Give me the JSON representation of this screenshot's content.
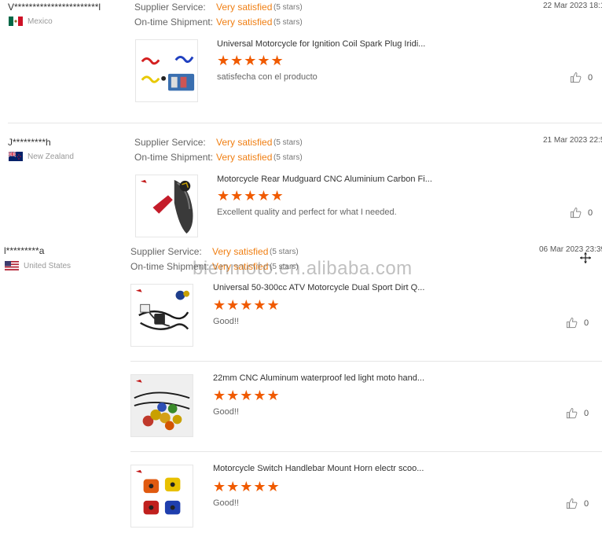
{
  "reviews": [
    {
      "buyer": "V***********************l",
      "country": "Mexico",
      "supplier_label": "Supplier Service:",
      "supplier_rating": "Very satisfied",
      "supplier_stars": "(5 stars)",
      "shipment_label": "On-time Shipment:",
      "shipment_rating": "Very satisfied",
      "shipment_stars": "(5 stars)",
      "date": "22 Mar 2023 18:1",
      "products": [
        {
          "title": "Universal Motorcycle for Ignition Coil Spark Plug Iridi...",
          "stars": "★★★★★",
          "comment": "satisfecha con el producto",
          "likes": "0"
        }
      ]
    },
    {
      "buyer": "J*********h",
      "country": "New Zealand",
      "supplier_label": "Supplier Service:",
      "supplier_rating": "Very satisfied",
      "supplier_stars": "(5 stars)",
      "shipment_label": "On-time Shipment:",
      "shipment_rating": "Very satisfied",
      "shipment_stars": "(5 stars)",
      "date": "21 Mar 2023 22:5",
      "products": [
        {
          "title": "Motorcycle Rear Mudguard CNC Aluminium Carbon Fi...",
          "stars": "★★★★★",
          "comment": "Excellent quality and perfect for what I needed.",
          "likes": "0"
        }
      ]
    },
    {
      "buyer": "l*********a",
      "country": "United States",
      "supplier_label": "Supplier Service:",
      "supplier_rating": "Very satisfied",
      "supplier_stars": "(5 stars)",
      "shipment_label": "On-time Shipment:",
      "shipment_rating": "Very satisfied",
      "shipment_stars": "(5 stars)",
      "date": "06 Mar 2023 23:39",
      "products": [
        {
          "title": "Universal 50-300cc ATV Motorcycle Dual Sport Dirt Q...",
          "stars": "★★★★★",
          "comment": "Good!!",
          "likes": "0"
        },
        {
          "title": "22mm CNC Aluminum waterproof led light moto hand...",
          "stars": "★★★★★",
          "comment": "Good!!",
          "likes": "0"
        },
        {
          "title": "Motorcycle Switch Handlebar Mount Horn electr scoo...",
          "stars": "★★★★★",
          "comment": "Good!!",
          "likes": "0"
        }
      ]
    }
  ],
  "watermark": "bienmoto.en.alibaba.com",
  "icons": {
    "like": "thumbs-up-icon",
    "cursor": "move-cursor-icon",
    "flags": [
      "mexico-flag-icon",
      "new-zealand-flag-icon",
      "united-states-flag-icon"
    ]
  },
  "colors": {
    "rating": "#f07f13",
    "star": "#f05a00"
  }
}
